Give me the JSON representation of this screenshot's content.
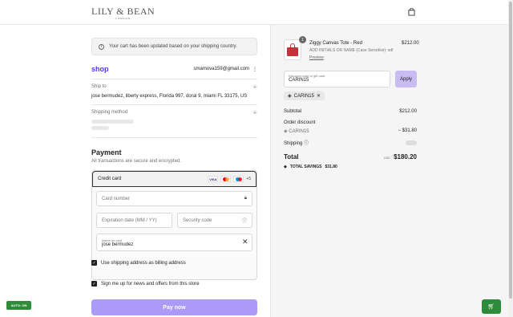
{
  "header": {
    "brand": "LILY BEAN",
    "brand_main": "LILY & BEAN",
    "brand_sub": "LONDON",
    "cart_icon": "shopping-bag-icon"
  },
  "notice": {
    "text": "Your cart has been updated based on your shipping country."
  },
  "contact": {
    "shop_label": "shop",
    "email": "smamova159@gmail.com",
    "menu_icon": "kebab-icon"
  },
  "ship_to": {
    "label": "Ship to",
    "address": "jose bermudez, liberty express, Florida 997, doral 9, miami FL 33175, US"
  },
  "shipping_method": {
    "label": "Shipping method"
  },
  "payment": {
    "title": "Payment",
    "subtitle": "All transactions are secure and encrypted.",
    "method": "Credit card",
    "cards": [
      "VISA",
      "mastercard",
      "maestro"
    ],
    "more": "+5",
    "card_number_placeholder": "Card number",
    "expiration_placeholder": "Expiration date (MM / YY)",
    "security_placeholder": "Security code",
    "name_label": "Name on card",
    "name_value": "jose bermudez",
    "billing_checkbox": "Use shipping address as billing address",
    "newsletter_checkbox": "Sign me up for news and offers from this store",
    "pay_button": "Pay now"
  },
  "auto": {
    "label": "AUTO: ON"
  },
  "order": {
    "product_name": "Ziggy Canvas Tote - Red",
    "product_variant": "ADD INITIALS OR NAME (Case Sensitive): sdf",
    "preview_link": "Preview",
    "quantity": "1",
    "product_price": "$212.00",
    "discount_label": "Discount code or gift card",
    "discount_value": "CARIN15",
    "apply_button": "Apply",
    "applied_code": "CARIN15",
    "subtotal_label": "Subtotal",
    "subtotal_value": "$212.00",
    "order_discount_label": "Order discount",
    "discount_code": "CARIN15",
    "discount_amount": "− $31.80",
    "shipping_label": "Shipping",
    "total_label": "Total",
    "currency": "USD",
    "total_value": "$180.20",
    "savings_label": "TOTAL SAVINGS",
    "savings_value": "$31.80"
  },
  "colors": {
    "shop_purple": "#5a31f4",
    "pay_button": "#ab9af7",
    "apply_button": "#c8bcf3",
    "auto_green": "#2e8b3a"
  }
}
